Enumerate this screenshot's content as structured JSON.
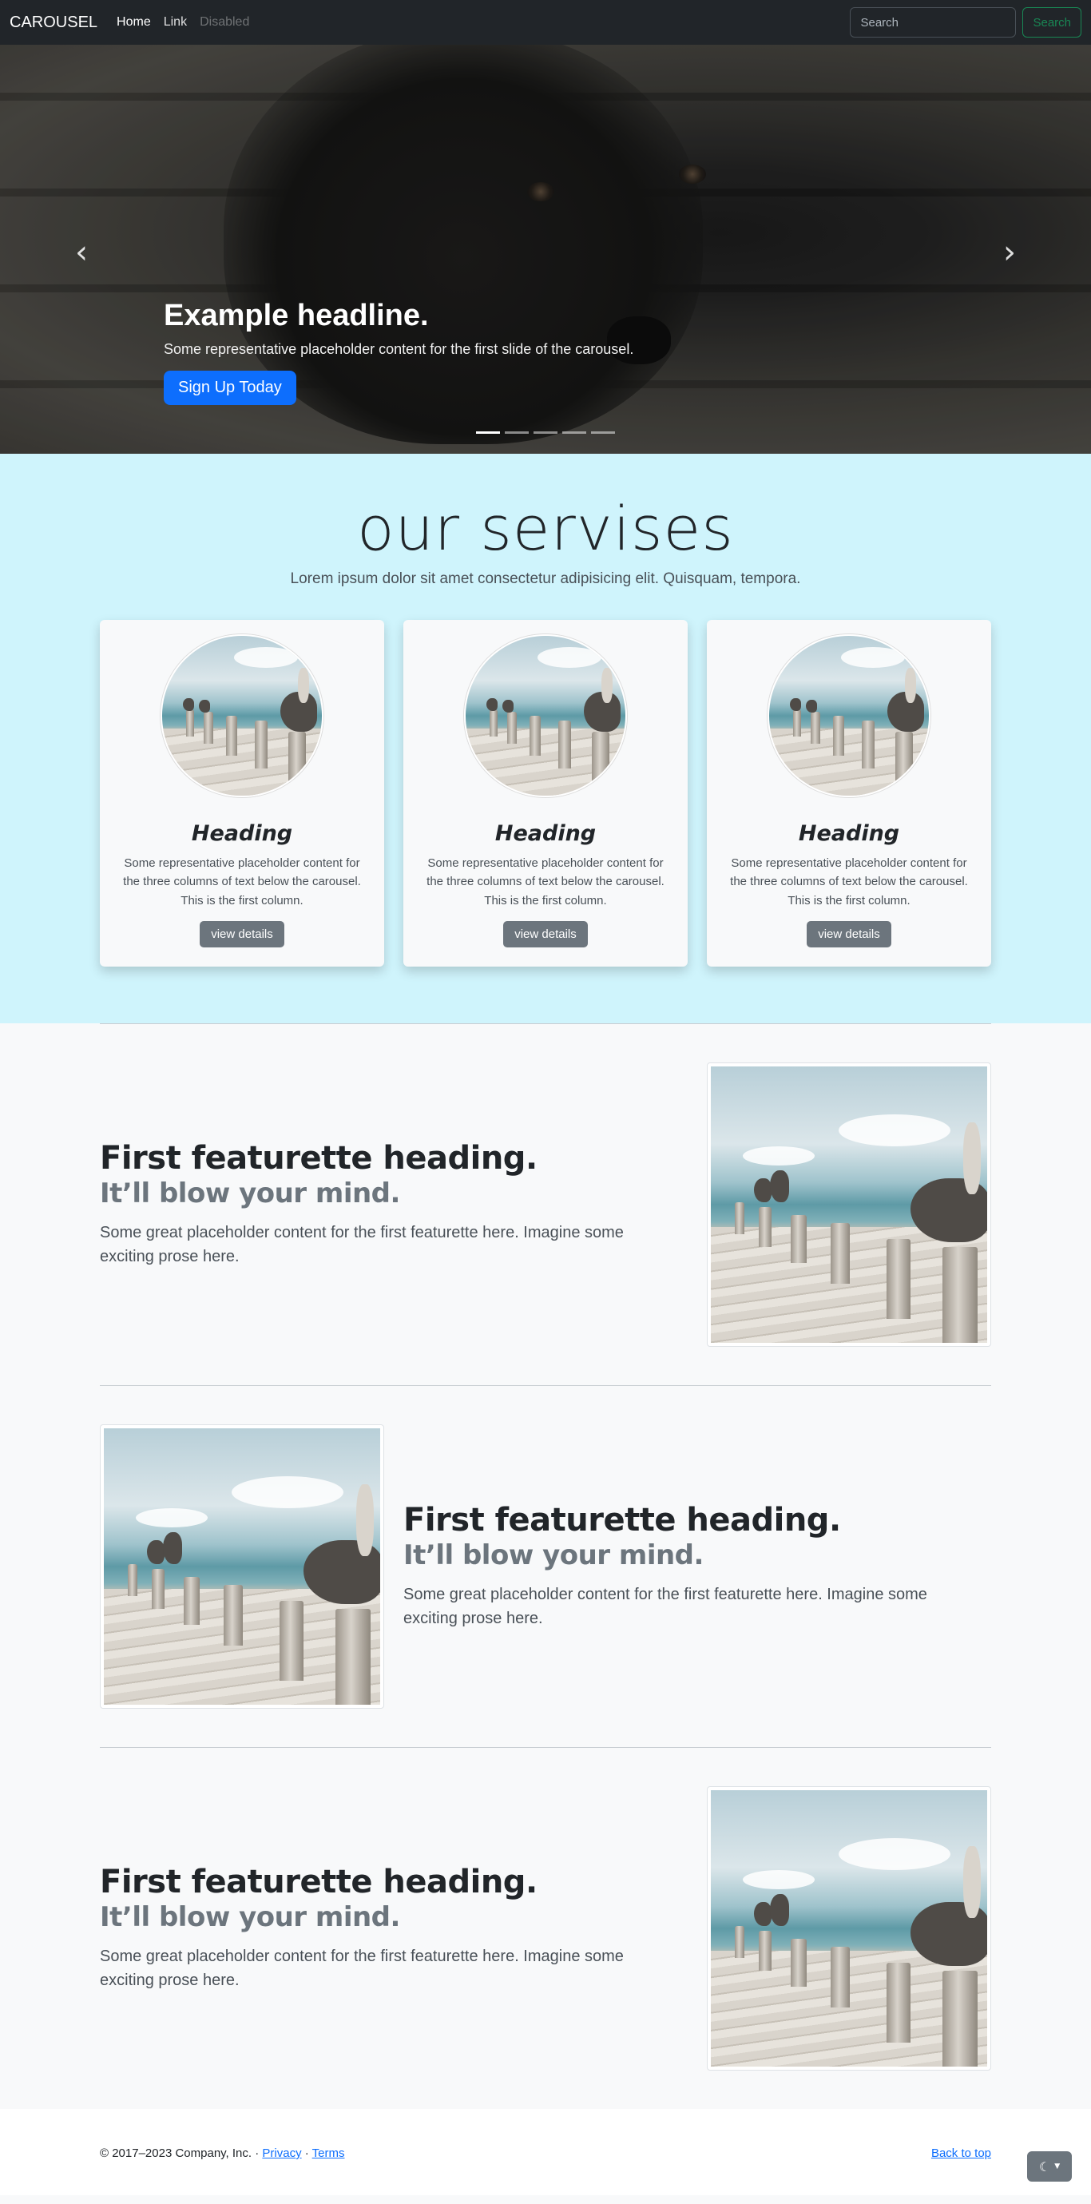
{
  "navbar": {
    "brand": "CAROUSEL",
    "links": [
      {
        "label": "Home",
        "state": "active"
      },
      {
        "label": "Link",
        "state": "normal"
      },
      {
        "label": "Disabled",
        "state": "disabled"
      }
    ],
    "search_placeholder": "Search",
    "search_button": "Search"
  },
  "carousel": {
    "headline": "Example headline.",
    "text": "Some representative placeholder content for the first slide of the carousel.",
    "cta": "Sign Up Today",
    "prev_icon": "chevron-left-icon",
    "next_icon": "chevron-right-icon",
    "slide_count": 5,
    "active_slide": 1
  },
  "services": {
    "title": "our servises",
    "lead": "Lorem ipsum dolor sit amet consectetur adipisicing elit. Quisquam, tempora.",
    "cards": [
      {
        "heading": "Heading",
        "text": "Some representative placeholder content for the three columns of text below the carousel. This is the first column.",
        "button": "view details"
      },
      {
        "heading": "Heading",
        "text": "Some representative placeholder content for the three columns of text below the carousel. This is the first column.",
        "button": "view details"
      },
      {
        "heading": "Heading",
        "text": "Some representative placeholder content for the three columns of text below the carousel. This is the first column.",
        "button": "view details"
      }
    ]
  },
  "featurettes": [
    {
      "heading": "First featurette heading.",
      "muted": "It’ll blow your mind.",
      "text": "Some great placeholder content for the first featurette here. Imagine some exciting prose here."
    },
    {
      "heading": "First featurette heading.",
      "muted": "It’ll blow your mind.",
      "text": "Some great placeholder content for the first featurette here. Imagine some exciting prose here."
    },
    {
      "heading": "First featurette heading.",
      "muted": "It’ll blow your mind.",
      "text": "Some great placeholder content for the first featurette here. Imagine some exciting prose here."
    }
  ],
  "footer": {
    "copyright": "© 2017–2023 Company, Inc. · ",
    "privacy": "Privacy",
    "separator": " · ",
    "terms": "Terms",
    "back_to_top": "Back to top",
    "theme_icon": "moon-icon"
  },
  "colors": {
    "navbar_bg": "#212529",
    "primary": "#0d6efd",
    "success": "#198754",
    "services_bg": "#cff4fc",
    "secondary": "#6c757d"
  }
}
